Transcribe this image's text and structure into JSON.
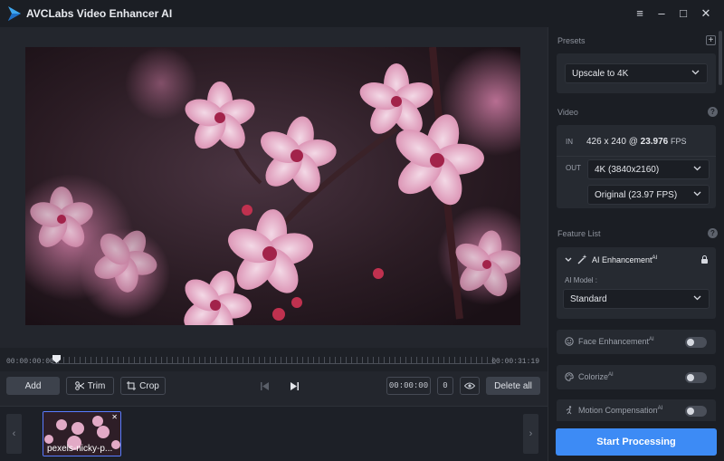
{
  "app": {
    "title": "AVCLabs Video Enhancer AI"
  },
  "window_controls": {
    "menu": "≡",
    "minimize": "–",
    "maximize": "□",
    "close": "✕"
  },
  "timeline": {
    "start_time": "00:00:00:00",
    "end_time": "00:00:31:19",
    "playhead_progress": 0.0
  },
  "toolbar": {
    "add_label": "Add",
    "trim_label": "Trim",
    "crop_label": "Crop",
    "time_field": "00:00:00",
    "frame_field": "0",
    "delete_all_label": "Delete all"
  },
  "filmstrip": {
    "items": [
      {
        "label": "pexels-nicky-p..."
      }
    ]
  },
  "presets": {
    "label": "Presets",
    "selected": "Upscale to 4K"
  },
  "video": {
    "label": "Video",
    "in_label": "IN",
    "in_res": "426 x 240 @",
    "in_fps": "23.976",
    "in_fps_unit": "FPS",
    "out_label": "OUT",
    "out_resolution": "4K (3840x2160)",
    "out_fps": "Original (23.97 FPS)"
  },
  "feature_list": {
    "label": "Feature List",
    "ai_enhancement": {
      "name": "AI Enhancement",
      "ai_tag": "AI",
      "model_label": "AI Model :",
      "model_value": "Standard"
    },
    "features": [
      {
        "name": "Face Enhancement",
        "ai_tag": "AI",
        "enabled": false
      },
      {
        "name": "Colorize",
        "ai_tag": "AI",
        "enabled": false
      },
      {
        "name": "Motion Compensation",
        "ai_tag": "AI",
        "enabled": false
      }
    ]
  },
  "start_button": {
    "label": "Start Processing"
  },
  "colors": {
    "accent": "#3d8bf5",
    "panel": "#1b1e24",
    "card": "#262a31"
  }
}
